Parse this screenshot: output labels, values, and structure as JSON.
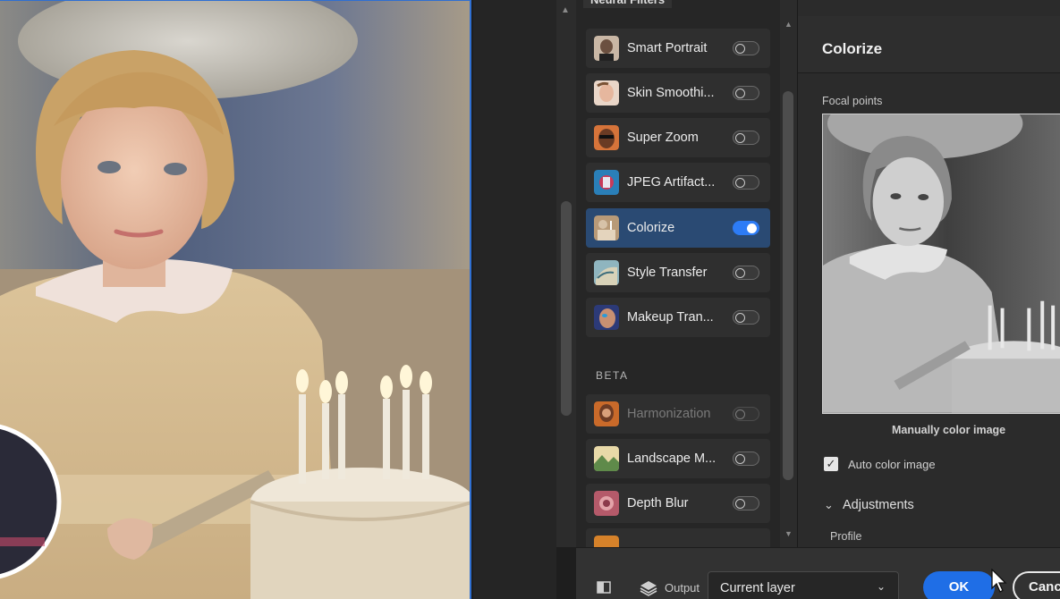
{
  "panel": {
    "title": "Neural Filters"
  },
  "filters": [
    {
      "label": "Smart Portrait",
      "enabled": false,
      "icon": "portrait-thumb",
      "active": false
    },
    {
      "label": "Skin Smoothi...",
      "enabled": false,
      "icon": "skin-thumb",
      "active": false
    },
    {
      "label": "Super Zoom",
      "enabled": false,
      "icon": "zoom-thumb",
      "active": false
    },
    {
      "label": "JPEG Artifact...",
      "enabled": false,
      "icon": "jpeg-thumb",
      "active": false
    },
    {
      "label": "Colorize",
      "enabled": true,
      "icon": "colorize-thumb",
      "active": true
    },
    {
      "label": "Style Transfer",
      "enabled": false,
      "icon": "style-thumb",
      "active": false
    },
    {
      "label": "Makeup Tran...",
      "enabled": false,
      "icon": "makeup-thumb",
      "active": false
    }
  ],
  "beta": {
    "heading": "BETA",
    "filters": [
      {
        "label": "Harmonization",
        "enabled": false,
        "icon": "harmonization-thumb",
        "dim": true
      },
      {
        "label": "Landscape M...",
        "enabled": false,
        "icon": "landscape-thumb",
        "dim": false
      },
      {
        "label": "Depth Blur",
        "enabled": false,
        "icon": "depth-thumb",
        "dim": false
      }
    ]
  },
  "settings": {
    "title": "Colorize",
    "focal_points_label": "Focal points",
    "manual_label": "Manually color image",
    "auto_color_label": "Auto color image",
    "auto_color_checked": true,
    "adjustments_label": "Adjustments",
    "profile_label": "Profile"
  },
  "bottom": {
    "output_label": "Output",
    "output_value": "Current layer",
    "ok_label": "OK",
    "cancel_label": "Canc"
  },
  "colors": {
    "accent": "#2d7cf6",
    "active_row": "#2a4a73",
    "ok": "#1f6ee6"
  }
}
